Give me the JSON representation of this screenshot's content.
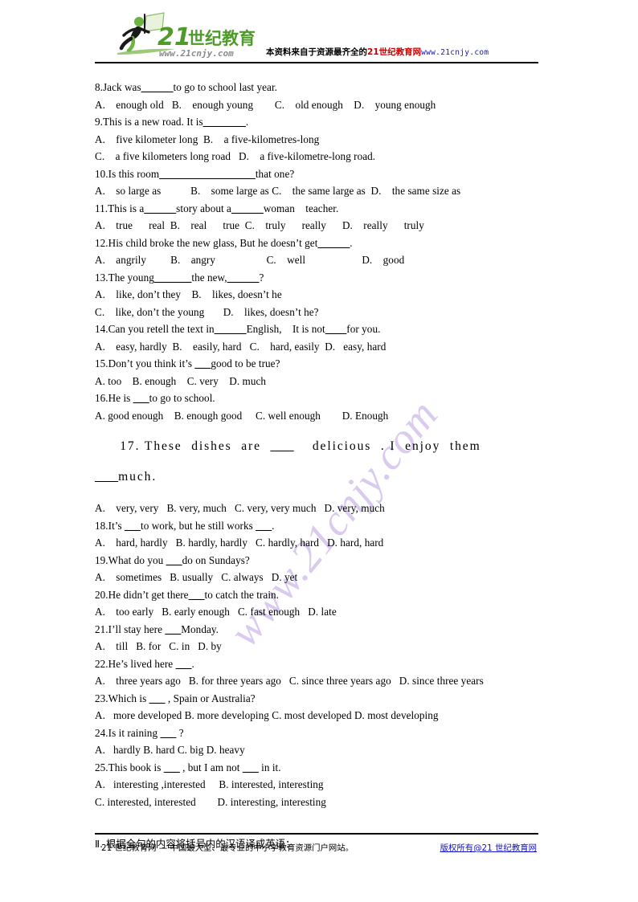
{
  "header": {
    "logo": {
      "brand_number": "21",
      "brand_cn": "世纪教育",
      "brand_url": "www.21cnjy.com",
      "icon": "running-man-with-flag-logo",
      "green": "#6cb33f",
      "dark": "#1a1a1a",
      "gray": "#7f7f7f"
    },
    "slogan_prefix": "本资料来自于资源最齐全的",
    "slogan_highlight": "21世纪教育网",
    "slogan_url": "www.21cnjy.com",
    "highlight_color": "#cc0000",
    "url_color": "#1111cc"
  },
  "watermark": {
    "text": "www.21cnjy.com",
    "color": "#cdb8e8",
    "rotation_deg": -51
  },
  "questions": [
    {
      "stem": "8.Jack was",
      "blank": "______",
      "stem_tail": "to go to school last year."
    },
    {
      "options_line": "A.    enough old   B.    enough young        C.    old enough    D.    young enough"
    },
    {
      "stem": "9.This is a new road. It is",
      "blank": "________",
      "stem_tail": "."
    },
    {
      "options_line": "A.    five kilometer long  B.    a five-kilometres-long"
    },
    {
      "options_line": "C.    a five kilometers long road   D.    a five-kilometre-long road."
    },
    {
      "stem": "10.Is this room",
      "blank": "__________________",
      "stem_tail": "that one?"
    },
    {
      "options_line": "A.    so large as           B.    some large as C.    the same large as  D.    the same size as"
    },
    {
      "stem": "11.This is a",
      "blank": "______",
      "stem_tail": "story about a",
      "blank2": "______",
      "stem_tail2": "woman    teacher."
    },
    {
      "options_line": "A.    true      real  B.    real      true  C.    truly      really      D.    really      truly"
    },
    {
      "stem": "12.His child broke the new glass, But he doesn’t get",
      "blank": "______",
      "stem_tail": "."
    },
    {
      "options_line": "A.    angrily         B.    angry                   C.    well                     D.    good"
    },
    {
      "stem": "13.The young",
      "blank": "_______",
      "stem_tail": "the new,",
      "blank2": "______",
      "stem_tail2": "?"
    },
    {
      "options_line": "A.    like, don’t they    B.    likes, doesn’t he"
    },
    {
      "options_line": "C.    like, don’t the young       D.    likes, doesn’t he?"
    },
    {
      "stem": "14.Can you retell the text in",
      "blank": "______",
      "stem_tail": "English,    It is not",
      "blank2": "____",
      "stem_tail2": "for you."
    },
    {
      "options_line": "A.    easy, hardly  B.    easily, hard   C.    hard, easily  D.   easy, hard"
    },
    {
      "stem": "15.Don’t you think it’s ",
      "blank": "___",
      "stem_tail": "good to be true?"
    },
    {
      "options_line": "A. too    B. enough    C. very    D. much"
    },
    {
      "stem": "16.He is ",
      "blank": "___",
      "stem_tail": "to go to school."
    },
    {
      "options_line": "A. good enough    B. enough good     C. well enough        D. Enough"
    }
  ],
  "big_question": {
    "line1_indent": "        ",
    "line1_a": "17. These  dishes  are  ",
    "line1_blank": "___",
    "line1_b": "    delicious  . I  enjoy  them",
    "line2_blank": "___",
    "line2_text": "much."
  },
  "questions_b": [
    {
      "options_line": "A.    very, very   B. very, much   C. very, very much   D. very, much"
    },
    {
      "stem": "18.It’s ",
      "blank": "___",
      "stem_tail": "to work, but he still works ",
      "blank2": "___",
      "stem_tail2": "."
    },
    {
      "options_line": "A.    hard, hardly   B. hardly, hardly   C. hardly, hard   D. hard, hard"
    },
    {
      "stem": "19.What do you ",
      "blank": "___",
      "stem_tail": "do on Sundays?"
    },
    {
      "options_line": "A.    sometimes   B. usually   C. always   D. yet"
    },
    {
      "stem": "20.He didn’t get there",
      "blank": "___",
      "stem_tail": "to catch the train."
    },
    {
      "options_line": "A.    too early   B. early enough   C. fast enough   D. late"
    },
    {
      "stem": "21.I’ll stay here ",
      "blank": "___",
      "stem_tail": "Monday."
    },
    {
      "options_line": "A.    till   B. for   C. in   D. by"
    },
    {
      "stem": "22.He’s lived here ",
      "blank": "___",
      "stem_tail": "."
    },
    {
      "options_line": "A.    three years ago   B. for three years ago   C. since three years ago   D. since three years"
    },
    {
      "stem": "23.Which is ",
      "blank": "___",
      "stem_tail": " , Spain or Australia?"
    },
    {
      "options_line": "A.   more developed B. more developing C. most developed D. most developing"
    },
    {
      "stem": "24.Is it raining ",
      "blank": "___",
      "stem_tail": " ?"
    },
    {
      "options_line": "A.   hardly B. hard C. big D. heavy"
    },
    {
      "stem": "25.This book is ",
      "blank": "___",
      "stem_tail": " , but I am not ",
      "blank2": "___",
      "stem_tail2": " in it."
    },
    {
      "options_line": "A.   interesting ,interested     B. interested, interesting"
    },
    {
      "options_line": "C. interested, interested        D. interesting, interesting"
    }
  ],
  "section_heading": "Ⅱ. 根据全句的内容将括号内的汉语译成英语：",
  "footer": {
    "left_text": "21 世纪教育网 — 中国最大型、最专业的中小学教育资源门户网站。",
    "link_text": "版权所有@21 世纪教育网",
    "link_color": "#1111cc"
  }
}
